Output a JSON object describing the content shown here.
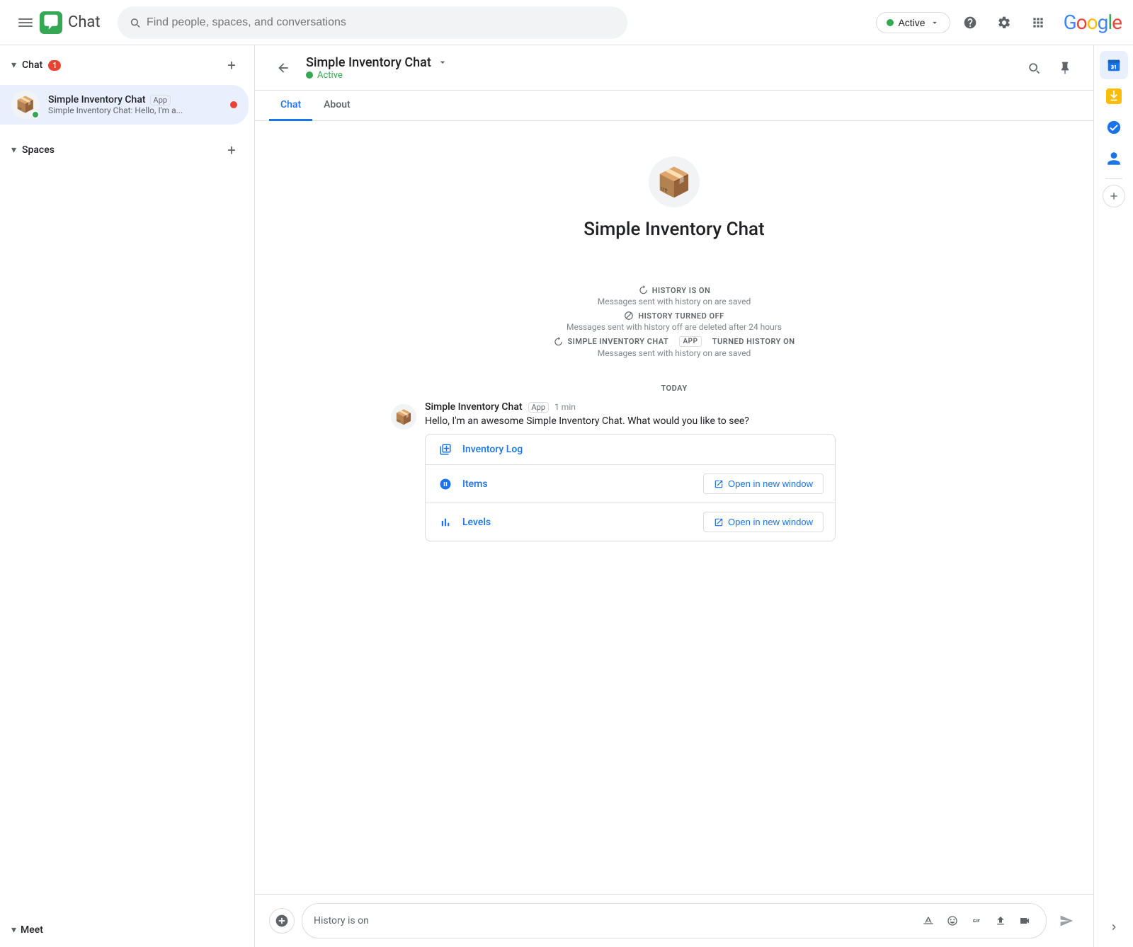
{
  "topbar": {
    "app_name": "Chat",
    "search_placeholder": "Find people, spaces, and conversations",
    "status_label": "Active",
    "google_text": "Google"
  },
  "sidebar": {
    "chat_section_label": "Chat",
    "chat_badge": "1",
    "spaces_section_label": "Spaces",
    "meet_section_label": "Meet",
    "add_icon": "+",
    "chat_items": [
      {
        "name": "Simple Inventory Chat",
        "badge": "App",
        "preview": "Simple Inventory Chat: Hello, I'm a...",
        "has_unread": true,
        "has_active_dot": true
      }
    ]
  },
  "chat_view": {
    "title": "Simple Inventory Chat",
    "title_status": "Active",
    "tab_chat": "Chat",
    "tab_about": "About",
    "bot_name": "Simple Inventory Chat",
    "history_on_label": "HISTORY IS ON",
    "history_on_sub": "Messages sent with history on are saved",
    "history_off_label": "HISTORY TURNED OFF",
    "history_off_sub": "Messages sent with history off are deleted after 24 hours",
    "history_on2_label": "SIMPLE INVENTORY CHAT",
    "history_on2_app": "APP",
    "history_on2_action": "TURNED HISTORY ON",
    "history_on2_sub": "Messages sent with history on are saved",
    "today_label": "TODAY",
    "message": {
      "sender": "Simple Inventory Chat",
      "badge": "App",
      "time": "1 min",
      "text": "Hello, I'm an awesome  Simple Inventory Chat. What would you like to see?",
      "card_items": [
        {
          "label": "Inventory Log",
          "has_open_btn": false
        },
        {
          "label": "Items",
          "has_open_btn": true,
          "open_btn_label": "Open in new window"
        },
        {
          "label": "Levels",
          "has_open_btn": true,
          "open_btn_label": "Open in new window"
        }
      ]
    },
    "input_placeholder": "History is on"
  },
  "right_rail": {
    "calendar_badge_color": "#fbbc05",
    "tasks_badge_color": "#1a73e8",
    "contacts_badge_color": "#34a853"
  }
}
